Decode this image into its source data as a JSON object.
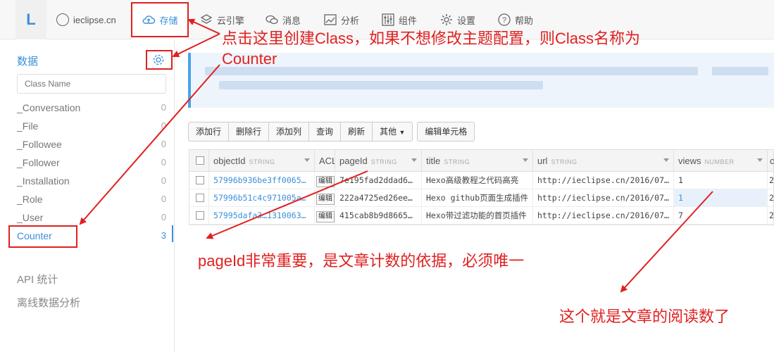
{
  "app": {
    "logo": "L",
    "name": "ieclipse.cn"
  },
  "nav": [
    {
      "label": "存储",
      "icon": "cloud-icon"
    },
    {
      "label": "云引擎",
      "icon": "layers-icon"
    },
    {
      "label": "消息",
      "icon": "chat-icon"
    },
    {
      "label": "分析",
      "icon": "chart-icon"
    },
    {
      "label": "组件",
      "icon": "sliders-icon"
    },
    {
      "label": "设置",
      "icon": "gear-icon"
    },
    {
      "label": "帮助",
      "icon": "help-icon"
    }
  ],
  "sidebar": {
    "title": "数据",
    "search_placeholder": "Class Name",
    "classes": [
      {
        "name": "_Conversation",
        "count": "0"
      },
      {
        "name": "_File",
        "count": "0"
      },
      {
        "name": "_Followee",
        "count": "0"
      },
      {
        "name": "_Follower",
        "count": "0"
      },
      {
        "name": "_Installation",
        "count": "0"
      },
      {
        "name": "_Role",
        "count": "0"
      },
      {
        "name": "_User",
        "count": "0"
      },
      {
        "name": "Counter",
        "count": "3"
      }
    ],
    "sections": [
      "API 统计",
      "离线数据分析"
    ]
  },
  "toolbar": {
    "buttons": [
      "添加行",
      "删除行",
      "添加列",
      "查询",
      "刷新",
      "其他"
    ],
    "edit_cell": "编辑单元格"
  },
  "table": {
    "columns": [
      {
        "name": "objectId",
        "type": "STRING"
      },
      {
        "name": "ACL",
        "type": ""
      },
      {
        "name": "pageId",
        "type": "STRING"
      },
      {
        "name": "title",
        "type": "STRING"
      },
      {
        "name": "url",
        "type": "STRING"
      },
      {
        "name": "views",
        "type": "NUMBER"
      },
      {
        "name": "c",
        "type": ""
      }
    ],
    "acl_button": "编辑",
    "rows": [
      {
        "objectId": "57996b936be3ff0065…",
        "pageId": "7e195fad2ddad6…",
        "title": "Hexo高级教程之代码高亮",
        "url": "http://ieclipse.cn/2016/07…",
        "views": "1",
        "extra": "2"
      },
      {
        "objectId": "57996b51c4c971005a…",
        "pageId": "222a4725ed26ee…",
        "title": "Hexo github页面生成插件",
        "url": "http://ieclipse.cn/2016/07…",
        "views": "1",
        "extra": "2"
      },
      {
        "objectId": "57995dafa3…1310063…",
        "pageId": "415cab8b9d8665…",
        "title": "Hexo带过滤功能的首页插件",
        "url": "http://ieclipse.cn/2016/07…",
        "views": "7",
        "extra": "2"
      }
    ]
  },
  "annotations": {
    "create_line1": "点击这里创建Class，如果不想修改主题配置，则Class名称为",
    "create_line2": "Counter",
    "pageid_note": "pageId非常重要，是文章计数的依据，必须唯一",
    "views_note": "这个就是文章的阅读数了"
  },
  "colors": {
    "accent": "#3b8fd8",
    "annotation": "#e02020"
  }
}
